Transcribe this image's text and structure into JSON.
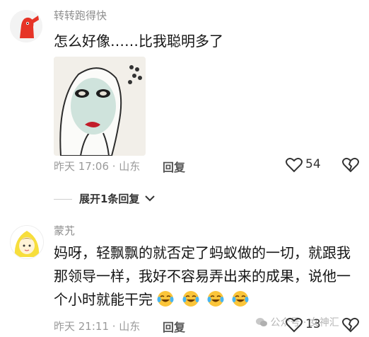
{
  "comments": [
    {
      "username": "转转跑得快",
      "text": "怎么好像……比我聪明多了",
      "time_location": "昨天 17:06 · 山东",
      "reply_label": "回复",
      "likes": "54"
    },
    {
      "username": "蒙艽",
      "text_lines": [
        "妈呀，轻飘飘的就否定了蚂蚁做的一切，就跟我",
        "那领导一样，我好不容易弄出来的成果，说他一",
        "个小时就能干完"
      ],
      "time_location": "昨天 21:11 · 山东",
      "reply_label": "回复",
      "likes": "13"
    }
  ],
  "expand_replies_label": "展开1条回复",
  "watermark": "公众号 · 女神汇",
  "icons": {
    "heart": "heart-outline-icon",
    "dislike": "broken-heart-icon",
    "chevron": "chevron-down-icon",
    "emoji": "crying-laughing-emoji"
  },
  "colors": {
    "text": "#151515",
    "meta": "#9a9a9a",
    "username": "#8e8e8e"
  }
}
